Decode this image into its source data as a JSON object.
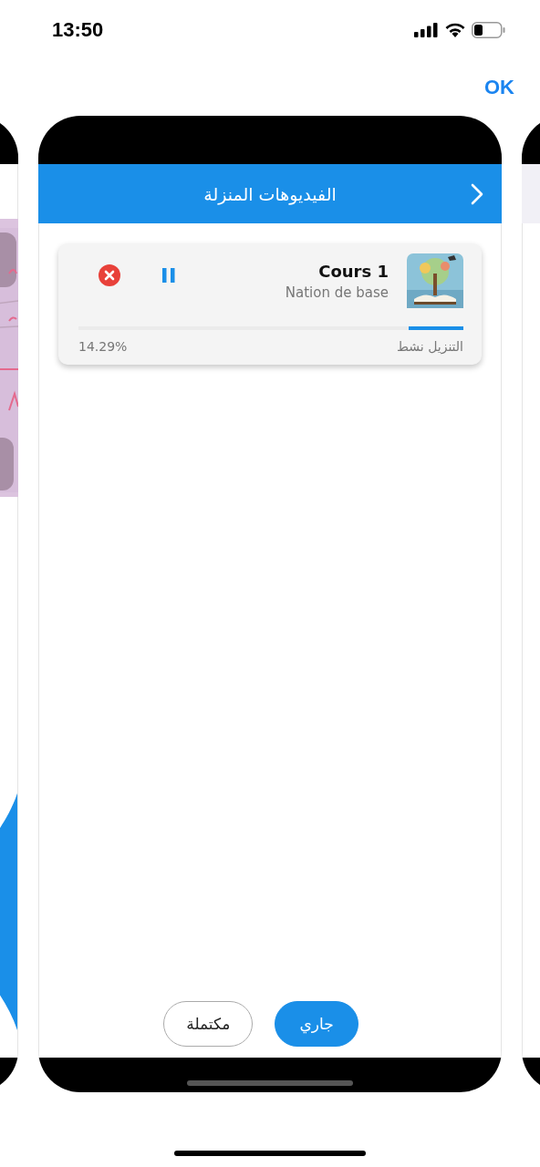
{
  "status_bar": {
    "time": "13:50"
  },
  "done_button": {
    "label": "OK"
  },
  "screen": {
    "title": "الفيديوهات المنزلة",
    "downloads": [
      {
        "title": "Cours 1",
        "subtitle": "Nation de base",
        "status": "التنزيل نشط",
        "percent": "14.29%",
        "level": 0.1429,
        "paused": false
      }
    ],
    "tabs": [
      {
        "label": "جاري",
        "selected": true
      },
      {
        "label": "مكتملة",
        "selected": false
      }
    ]
  }
}
